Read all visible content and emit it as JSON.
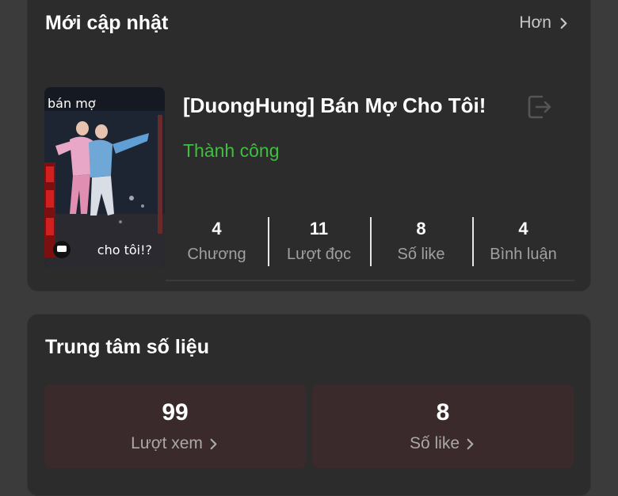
{
  "updates": {
    "title": "Mới cập nhật",
    "more_label": "Hơn",
    "book": {
      "cover_text_top": "bán mợ",
      "cover_text_bottom": "cho tôi!?",
      "title": "[DuongHung] Bán Mợ Cho Tôi!",
      "status": "Thành công",
      "stats": [
        {
          "value": "4",
          "label": "Chương"
        },
        {
          "value": "11",
          "label": "Lượt đọc"
        },
        {
          "value": "8",
          "label": "Số like"
        },
        {
          "value": "4",
          "label": "Bình luận"
        }
      ]
    }
  },
  "data_center": {
    "title": "Trung tâm số liệu",
    "tiles": [
      {
        "value": "99",
        "label": "Lượt xem"
      },
      {
        "value": "8",
        "label": "Số like"
      }
    ]
  },
  "colors": {
    "background": "#3b3b3b",
    "card": "#2c2c2c",
    "status_green": "#3fbe3f",
    "tile": "#3a2a2b"
  },
  "icons": {
    "more": "chevron-right-icon",
    "action": "exit-icon"
  }
}
